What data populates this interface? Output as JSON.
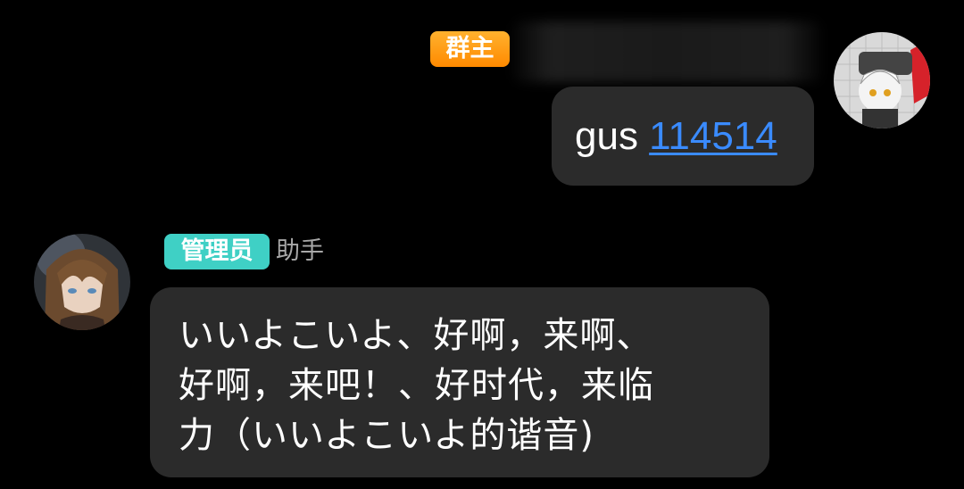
{
  "owner_message": {
    "badge": "群主",
    "text_prefix": "gus ",
    "link_text": "114514"
  },
  "admin_message": {
    "badge": "管理员",
    "sender_name": "助手",
    "lines": [
      "いいよこいよ、好啊，来啊、",
      "好啊，来吧！、好时代，来临",
      "力（いいよこいよ的谐音)"
    ]
  },
  "colors": {
    "background": "#000000",
    "bubble": "#2b2b2b",
    "owner_badge": "#ff9a1a",
    "admin_badge": "#3fd0c5",
    "link": "#3a8bff",
    "sender_name": "#a8a8a8"
  },
  "icons": {
    "owner_avatar": "minesweeper-anime-avatar",
    "admin_avatar": "anime-girl-avatar"
  }
}
